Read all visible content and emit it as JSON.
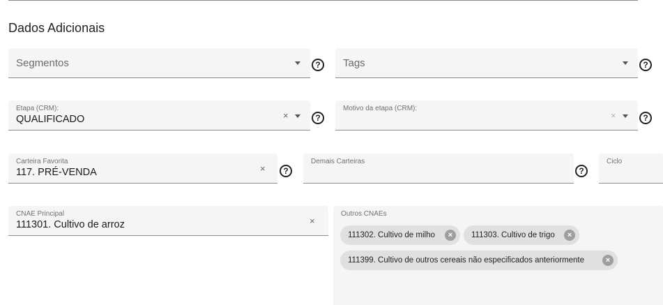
{
  "section": {
    "title": "Dados Adicionais"
  },
  "segmentos": {
    "placeholder": "Segmentos"
  },
  "tags": {
    "placeholder": "Tags"
  },
  "etapa": {
    "label": "Etapa (CRM):",
    "value": "QUALIFICADO"
  },
  "motivo": {
    "label": "Motivo da etapa (CRM):",
    "value": ""
  },
  "carteira": {
    "label": "Carteira Favorita",
    "value": "117. PRÉ-VENDA"
  },
  "demais": {
    "label": "Demais Carteiras"
  },
  "ciclo": {
    "label": "Ciclo"
  },
  "cnae": {
    "label": "CNAE Principal",
    "value": "111301. Cultivo de arroz"
  },
  "outros": {
    "label": "Outros CNAEs",
    "chips": [
      "111302. Cultivo de milho",
      "111303. Cultivo de trigo",
      "111399. Cultivo de outros cereais não especificados anteriormente"
    ]
  },
  "icons": {
    "help": "?",
    "clear": "×",
    "chip_remove": "×",
    "caret": "dropdown-caret"
  }
}
